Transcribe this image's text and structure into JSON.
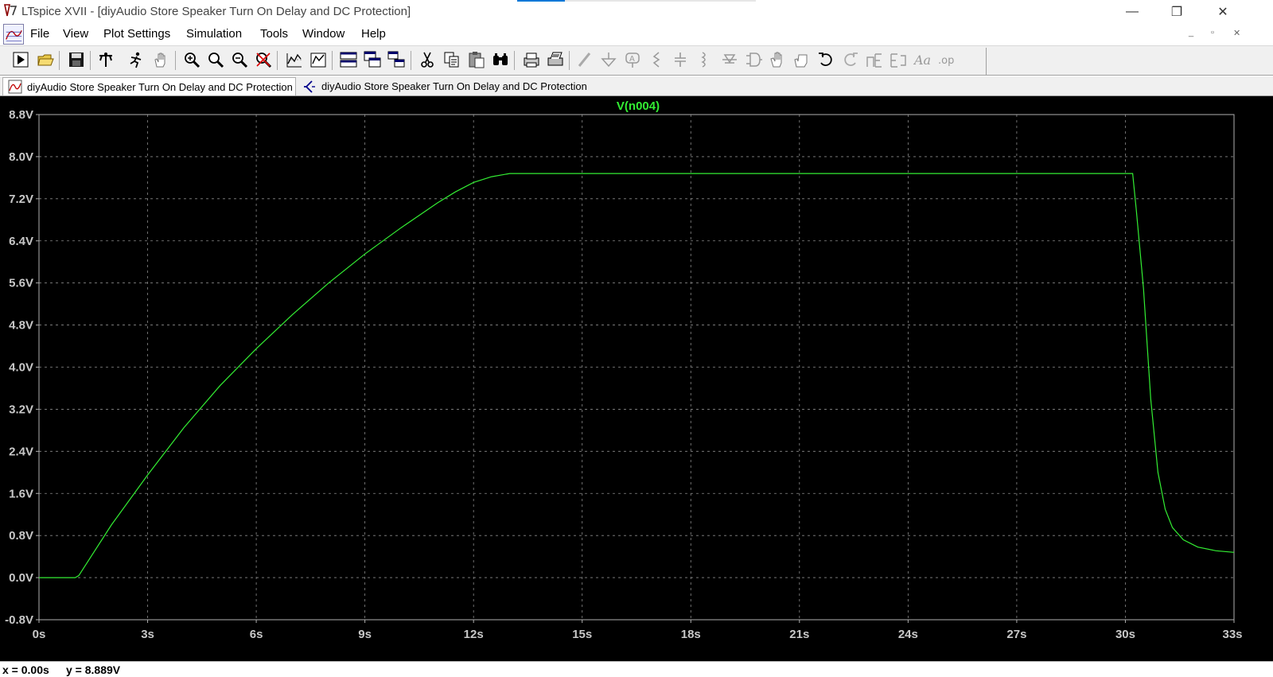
{
  "window": {
    "title": "LTspice XVII - [diyAudio Store Speaker Turn On Delay and DC Protection]",
    "controls": {
      "minimize": "—",
      "restore": "❐",
      "close": "✕"
    }
  },
  "menu": {
    "items": [
      "File",
      "View",
      "Plot Settings",
      "Simulation",
      "Tools",
      "Window",
      "Help"
    ],
    "mdi_controls": [
      "_",
      "▫",
      "✕"
    ]
  },
  "toolbar": {
    "buttons": [
      "run-icon",
      "open-icon",
      "save-icon",
      "control-panel-icon",
      "halt-icon",
      "pan-icon",
      "zoom-in-icon",
      "zoom-area-icon",
      "zoom-out-icon",
      "zoom-fit-icon",
      "autorange-icon",
      "plot-settings-icon",
      "tile-horizontal-icon",
      "cascade-icon",
      "tile-vertical-icon",
      "cut-icon",
      "copy-icon",
      "paste-icon",
      "find-icon",
      "print-preview-icon",
      "print-icon",
      "wire-icon",
      "ground-icon",
      "label-icon",
      "resistor-icon",
      "capacitor-icon",
      "inductor-icon",
      "diode-icon",
      "component-icon",
      "move-icon",
      "drag-icon",
      "undo-icon",
      "redo-icon",
      "rotate-icon",
      "mirror-icon",
      "text-icon",
      "spice-directive-icon"
    ]
  },
  "tabs": [
    {
      "label": "diyAudio Store Speaker Turn On Delay and DC Protection",
      "kind": "waveform",
      "active": true
    },
    {
      "label": "diyAudio Store Speaker Turn On Delay and DC Protection",
      "kind": "schematic",
      "active": false
    }
  ],
  "plot": {
    "background": "#000000",
    "trace_color": "#33ee33",
    "axis_color": "#b0b0b0",
    "label_color": "#c8c8c8"
  },
  "chart_data": {
    "type": "line",
    "title": "V(n004)",
    "xlabel": "",
    "ylabel": "",
    "xlim": [
      0,
      33
    ],
    "ylim": [
      -0.8,
      8.8
    ],
    "grid": true,
    "x_ticks": [
      "0s",
      "3s",
      "6s",
      "9s",
      "12s",
      "15s",
      "18s",
      "21s",
      "24s",
      "27s",
      "30s",
      "33s"
    ],
    "y_ticks": [
      "8.8V",
      "8.0V",
      "7.2V",
      "6.4V",
      "5.6V",
      "4.8V",
      "4.0V",
      "3.2V",
      "2.4V",
      "1.6V",
      "0.8V",
      "0.0V",
      "-0.8V"
    ],
    "series": [
      {
        "name": "V(n004)",
        "x": [
          0,
          1.0,
          1.1,
          2.0,
          3.0,
          4.0,
          5.0,
          6.0,
          7.0,
          8.0,
          9.0,
          10.0,
          11.0,
          11.5,
          12.0,
          12.5,
          13.0,
          14.0,
          20.0,
          25.0,
          30.0,
          30.2,
          30.3,
          30.5,
          30.7,
          30.9,
          31.1,
          31.3,
          31.6,
          32.0,
          32.5,
          33.0
        ],
        "y": [
          0,
          0,
          0.04,
          1.0,
          1.95,
          2.85,
          3.65,
          4.35,
          5.0,
          5.6,
          6.15,
          6.65,
          7.12,
          7.33,
          7.51,
          7.62,
          7.68,
          7.68,
          7.68,
          7.68,
          7.68,
          7.68,
          7.0,
          5.5,
          3.4,
          2.0,
          1.3,
          0.95,
          0.72,
          0.58,
          0.51,
          0.48
        ]
      }
    ]
  },
  "status": {
    "x": "x = 0.00s",
    "y": "y = 8.889V"
  }
}
